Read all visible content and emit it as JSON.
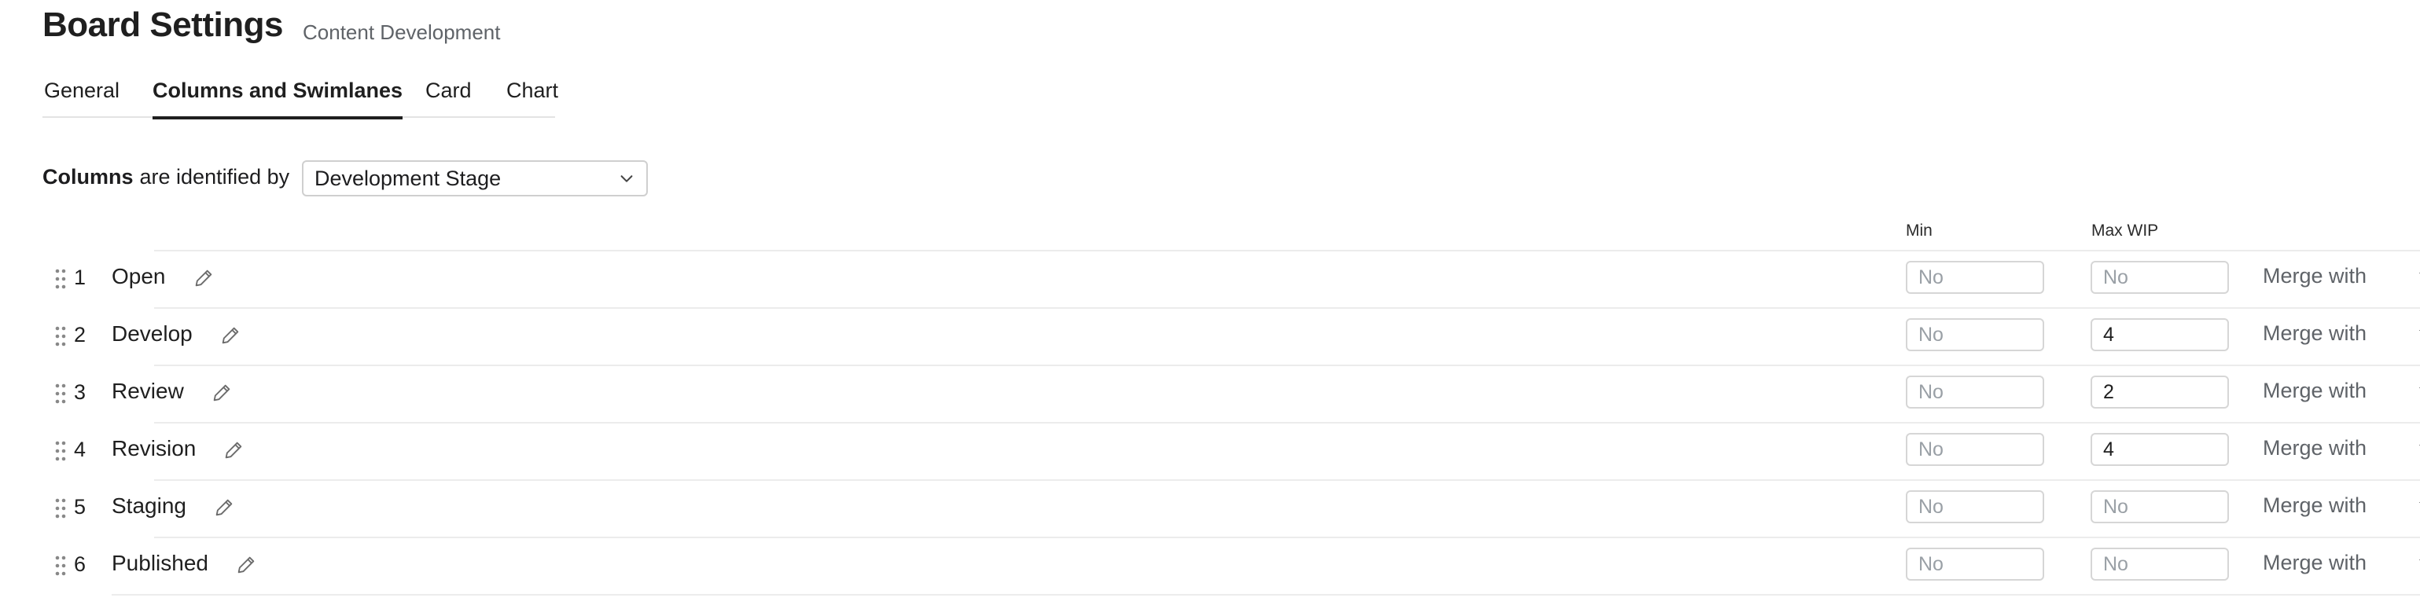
{
  "header": {
    "title": "Board Settings",
    "subtitle": "Content Development"
  },
  "tabs": [
    {
      "label": "General",
      "active": false
    },
    {
      "label": "Columns and Swimlanes",
      "active": true
    },
    {
      "label": "Card",
      "active": false
    },
    {
      "label": "Chart",
      "active": false
    }
  ],
  "identification": {
    "strong": "Columns",
    "rest": "are identified by",
    "selected": "Development Stage"
  },
  "table": {
    "min_header": "Min",
    "max_header": "Max WIP",
    "merge_label": "Merge with",
    "rows": [
      {
        "index": "1",
        "name": "Open",
        "min": "",
        "min_placeholder": "No",
        "max": "",
        "max_placeholder": "No"
      },
      {
        "index": "2",
        "name": "Develop",
        "min": "",
        "min_placeholder": "No",
        "max": "4",
        "max_placeholder": "No"
      },
      {
        "index": "3",
        "name": "Review",
        "min": "",
        "min_placeholder": "No",
        "max": "2",
        "max_placeholder": "No"
      },
      {
        "index": "4",
        "name": "Revision",
        "min": "",
        "min_placeholder": "No",
        "max": "4",
        "max_placeholder": "No"
      },
      {
        "index": "5",
        "name": "Staging",
        "min": "",
        "min_placeholder": "No",
        "max": "",
        "max_placeholder": "No"
      },
      {
        "index": "6",
        "name": "Published",
        "min": "",
        "min_placeholder": "No",
        "max": "",
        "max_placeholder": "No"
      }
    ]
  },
  "icons": {
    "drag": "drag-handle-icon",
    "edit": "pencil-icon",
    "caret": "caret-down-icon",
    "remove": "close-icon",
    "chevron": "chevron-down-icon"
  }
}
